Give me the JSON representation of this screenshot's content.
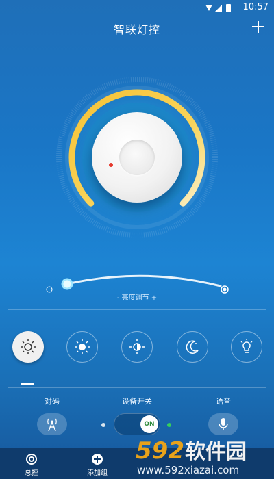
{
  "status_bar": {
    "time": "10:57"
  },
  "app": {
    "title": "智联灯控"
  },
  "slider": {
    "label": "- 亮度调节 +"
  },
  "modes": [
    "bright-mode",
    "sun-mode",
    "half-light-mode",
    "night-mode",
    "bulb-mode"
  ],
  "controls": {
    "pair_label": "对码",
    "switch_label": "设备开关",
    "voice_label": "语音",
    "switch_state": "ON"
  },
  "bottom_nav": [
    {
      "label": "总控"
    },
    {
      "label": "添加组"
    }
  ],
  "watermark": {
    "logo": "592软件园",
    "url": "www.592xiazai.com"
  },
  "colors": {
    "accent_yellow": "#f7c43a",
    "switch_green": "#2e8a3b",
    "nav_bg": "#0f3b6c"
  }
}
